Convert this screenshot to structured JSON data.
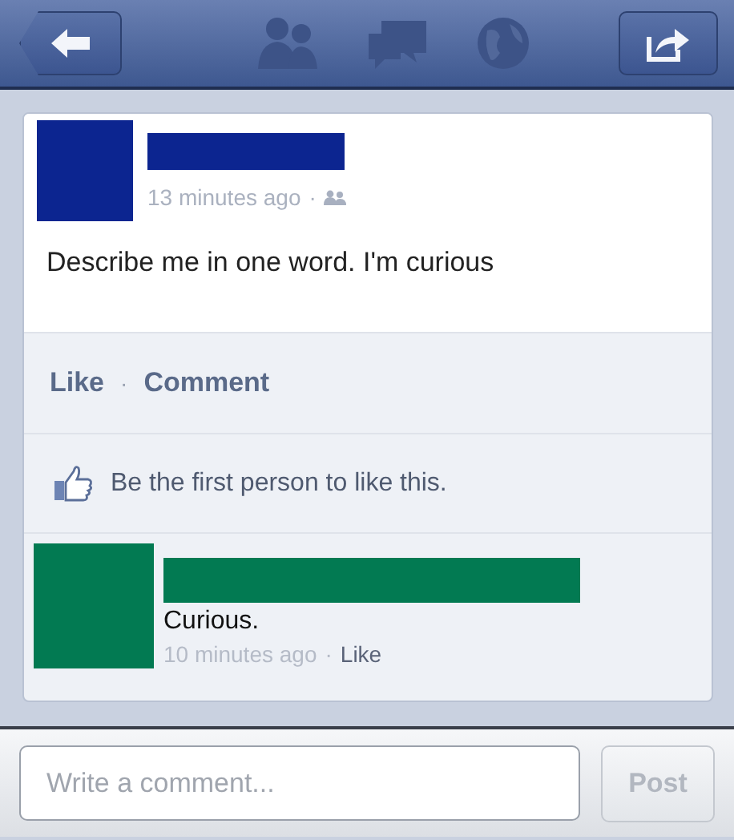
{
  "post": {
    "time": "13 minutes ago",
    "separator": "·",
    "text": "Describe me in one word. I'm curious"
  },
  "actions": [
    {
      "label": "Like"
    },
    {
      "label": "Comment"
    }
  ],
  "action_separator": "·",
  "likes": {
    "text": "Be the first person to like this."
  },
  "comments": [
    {
      "text": "Curious.",
      "time": "10 minutes ago",
      "separator": "·",
      "action": "Like"
    }
  ],
  "composer": {
    "placeholder": "Write a comment...",
    "button": {
      "label": "Post",
      "disabled": true
    }
  }
}
